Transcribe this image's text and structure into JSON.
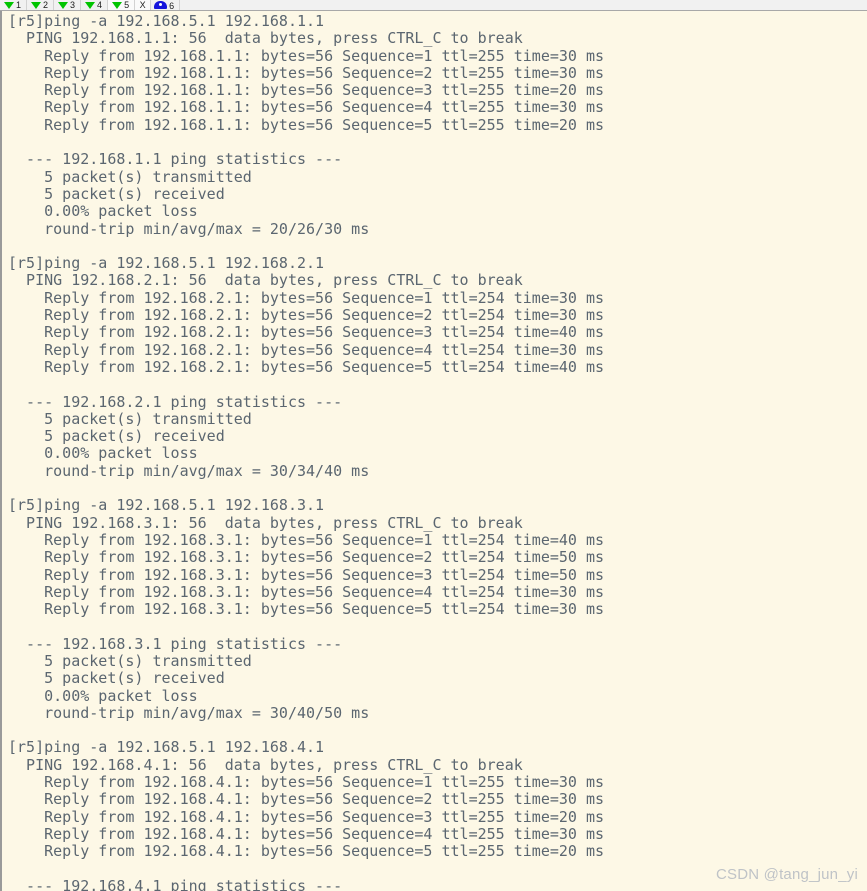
{
  "toolbar": {
    "tabs": [
      {
        "label": "1",
        "icon": "green-down-arrow-icon",
        "active": false
      },
      {
        "label": "2",
        "icon": "green-down-arrow-icon",
        "active": false
      },
      {
        "label": "3",
        "icon": "green-down-arrow-icon",
        "active": false
      },
      {
        "label": "4",
        "icon": "green-down-arrow-icon",
        "active": false
      },
      {
        "label": "5",
        "icon": "green-down-arrow-icon",
        "active": true
      }
    ],
    "close_label": "X",
    "badge": {
      "label": "6",
      "icon": "blue-device-icon"
    }
  },
  "console": {
    "prompt": "[r5]",
    "lines": [
      "[r5]ping -a 192.168.5.1 192.168.1.1",
      "  PING 192.168.1.1: 56  data bytes, press CTRL_C to break",
      "    Reply from 192.168.1.1: bytes=56 Sequence=1 ttl=255 time=30 ms",
      "    Reply from 192.168.1.1: bytes=56 Sequence=2 ttl=255 time=30 ms",
      "    Reply from 192.168.1.1: bytes=56 Sequence=3 ttl=255 time=20 ms",
      "    Reply from 192.168.1.1: bytes=56 Sequence=4 ttl=255 time=30 ms",
      "    Reply from 192.168.1.1: bytes=56 Sequence=5 ttl=255 time=20 ms",
      "",
      "  --- 192.168.1.1 ping statistics ---",
      "    5 packet(s) transmitted",
      "    5 packet(s) received",
      "    0.00% packet loss",
      "    round-trip min/avg/max = 20/26/30 ms",
      "",
      "[r5]ping -a 192.168.5.1 192.168.2.1",
      "  PING 192.168.2.1: 56  data bytes, press CTRL_C to break",
      "    Reply from 192.168.2.1: bytes=56 Sequence=1 ttl=254 time=30 ms",
      "    Reply from 192.168.2.1: bytes=56 Sequence=2 ttl=254 time=30 ms",
      "    Reply from 192.168.2.1: bytes=56 Sequence=3 ttl=254 time=40 ms",
      "    Reply from 192.168.2.1: bytes=56 Sequence=4 ttl=254 time=30 ms",
      "    Reply from 192.168.2.1: bytes=56 Sequence=5 ttl=254 time=40 ms",
      "",
      "  --- 192.168.2.1 ping statistics ---",
      "    5 packet(s) transmitted",
      "    5 packet(s) received",
      "    0.00% packet loss",
      "    round-trip min/avg/max = 30/34/40 ms",
      "",
      "[r5]ping -a 192.168.5.1 192.168.3.1",
      "  PING 192.168.3.1: 56  data bytes, press CTRL_C to break",
      "    Reply from 192.168.3.1: bytes=56 Sequence=1 ttl=254 time=40 ms",
      "    Reply from 192.168.3.1: bytes=56 Sequence=2 ttl=254 time=50 ms",
      "    Reply from 192.168.3.1: bytes=56 Sequence=3 ttl=254 time=50 ms",
      "    Reply from 192.168.3.1: bytes=56 Sequence=4 ttl=254 time=30 ms",
      "    Reply from 192.168.3.1: bytes=56 Sequence=5 ttl=254 time=30 ms",
      "",
      "  --- 192.168.3.1 ping statistics ---",
      "    5 packet(s) transmitted",
      "    5 packet(s) received",
      "    0.00% packet loss",
      "    round-trip min/avg/max = 30/40/50 ms",
      "",
      "[r5]ping -a 192.168.5.1 192.168.4.1",
      "  PING 192.168.4.1: 56  data bytes, press CTRL_C to break",
      "    Reply from 192.168.4.1: bytes=56 Sequence=1 ttl=255 time=30 ms",
      "    Reply from 192.168.4.1: bytes=56 Sequence=2 ttl=255 time=30 ms",
      "    Reply from 192.168.4.1: bytes=56 Sequence=3 ttl=255 time=20 ms",
      "    Reply from 192.168.4.1: bytes=56 Sequence=4 ttl=255 time=30 ms",
      "    Reply from 192.168.4.1: bytes=56 Sequence=5 ttl=255 time=20 ms",
      "",
      "  --- 192.168.4.1 ping statistics ---"
    ]
  },
  "watermark": {
    "text": "CSDN @tang_jun_yi"
  },
  "colors": {
    "console_background": "#fdf8e6",
    "console_text": "#5b6670",
    "toolbar_background": "#f1f1f1",
    "tab_arrow": "#00c400",
    "badge": "#1414dc",
    "watermark": "#bfc3c7"
  }
}
